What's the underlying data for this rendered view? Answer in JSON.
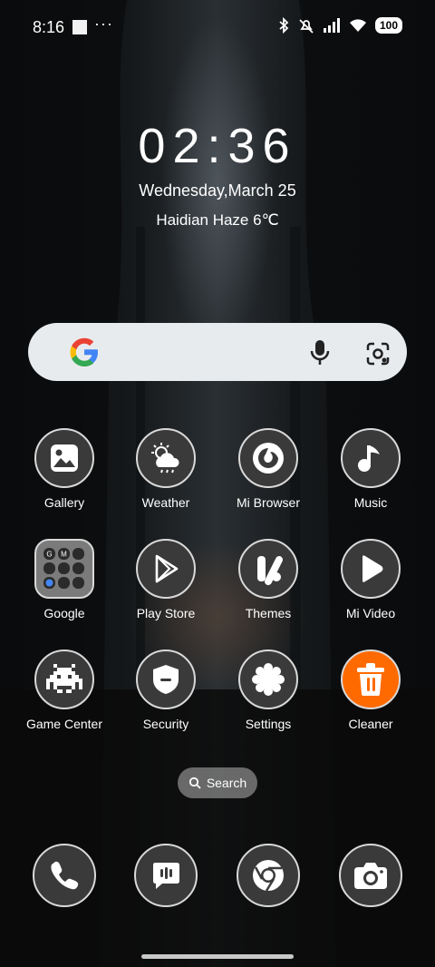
{
  "status": {
    "time": "8:16",
    "dots": "···",
    "battery": "100",
    "icons": [
      "bluetooth-icon",
      "mute-icon",
      "signal-icon",
      "wifi-icon",
      "battery-icon"
    ]
  },
  "clock": {
    "time": "02:36",
    "date": "Wednesday,March 25",
    "weather": "Haidian Haze 6℃"
  },
  "search": {
    "icons": [
      "google-logo",
      "mic-icon",
      "lens-icon"
    ]
  },
  "apps": [
    {
      "label": "Gallery",
      "icon": "gallery-icon"
    },
    {
      "label": "Weather",
      "icon": "weather-icon"
    },
    {
      "label": "Mi Browser",
      "icon": "browser-icon"
    },
    {
      "label": "Music",
      "icon": "music-icon"
    },
    {
      "label": "Google",
      "icon": "google-folder-icon"
    },
    {
      "label": "Play Store",
      "icon": "play-store-icon"
    },
    {
      "label": "Themes",
      "icon": "themes-icon"
    },
    {
      "label": "Mi Video",
      "icon": "video-icon"
    },
    {
      "label": "Game Center",
      "icon": "game-center-icon"
    },
    {
      "label": "Security",
      "icon": "security-icon"
    },
    {
      "label": "Settings",
      "icon": "settings-icon"
    },
    {
      "label": "Cleaner",
      "icon": "cleaner-icon"
    }
  ],
  "search_pill": {
    "label": "Search"
  },
  "dock": [
    {
      "icon": "phone-icon"
    },
    {
      "icon": "messages-icon"
    },
    {
      "icon": "chrome-icon"
    },
    {
      "icon": "camera-icon"
    }
  ],
  "colors": {
    "cleaner": "#ff6a00",
    "icon_bg": "#3a3a3a",
    "searchbar": "#e8ebee"
  }
}
